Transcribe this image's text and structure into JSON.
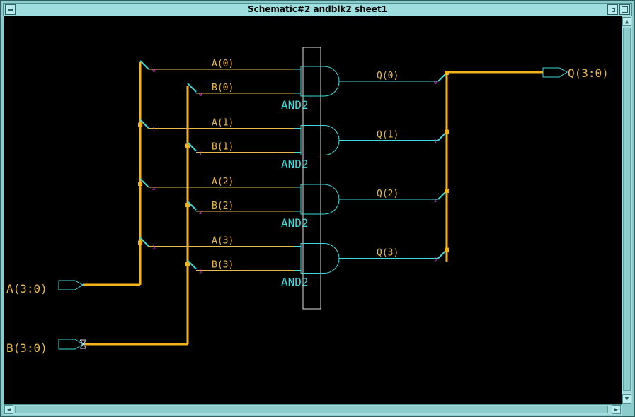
{
  "window": {
    "title": "Schematic#2 andblk2 sheet1"
  },
  "colors": {
    "bus": "#f2b31c",
    "gate": "#40d8d8",
    "net": "#e8b84a",
    "index": "#e040e0",
    "background": "#000000"
  },
  "icons": {
    "system_menu": "dash-icon",
    "minimize": "minimize-icon",
    "maximize": "maximize-icon"
  },
  "ports": {
    "a": "A(3:0)",
    "b": "B(3:0)",
    "q": "Q(3:0)"
  },
  "gates": [
    {
      "label": "AND2",
      "a_net": "A(0)",
      "b_net": "B(0)",
      "q_net": "Q(0)",
      "index": "0"
    },
    {
      "label": "AND2",
      "a_net": "A(1)",
      "b_net": "B(1)",
      "q_net": "Q(1)",
      "index": "1"
    },
    {
      "label": "AND2",
      "a_net": "A(2)",
      "b_net": "B(2)",
      "q_net": "Q(2)",
      "index": "2"
    },
    {
      "label": "AND2",
      "a_net": "A(3)",
      "b_net": "B(3)",
      "q_net": "Q(3)",
      "index": "3"
    }
  ]
}
